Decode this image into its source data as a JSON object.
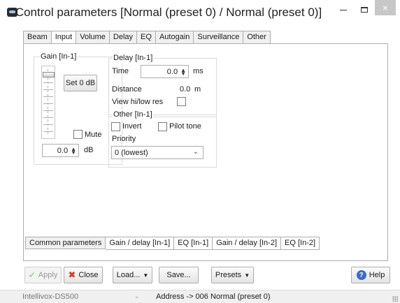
{
  "window": {
    "title": "Control parameters [Normal (preset 0) / Normal (preset 0)]",
    "close_glyph": "×"
  },
  "tabs": [
    {
      "label": "Beam"
    },
    {
      "label": "Input"
    },
    {
      "label": "Volume"
    },
    {
      "label": "Delay"
    },
    {
      "label": "EQ"
    },
    {
      "label": "Autogain"
    },
    {
      "label": "Surveillance"
    },
    {
      "label": "Other"
    }
  ],
  "active_tab": "Input",
  "gain": {
    "group_label": "Gain [In-1]",
    "set0_label": "Set 0 dB",
    "mute_label": "Mute",
    "mute_checked": false,
    "value": "0.0",
    "unit": "dB"
  },
  "delay": {
    "group_label": "Delay [In-1]",
    "time_label": "Time",
    "time_value": "0.0",
    "time_unit": "ms",
    "distance_label": "Distance",
    "distance_value": "0.0",
    "distance_unit": "m",
    "view_res_label": "View hi/low res",
    "view_res_checked": false
  },
  "other": {
    "group_label": "Other [In-1]",
    "invert_label": "Invert",
    "invert_checked": false,
    "pilot_label": "Pilot tone",
    "pilot_checked": false,
    "priority_label": "Priority",
    "priority_value": "0 (lowest)"
  },
  "bottom_tabs": [
    {
      "label": "Common parameters"
    },
    {
      "label": "Gain / delay [In-1]"
    },
    {
      "label": "EQ [In-1]"
    },
    {
      "label": "Gain / delay [In-2]"
    },
    {
      "label": "EQ [In-2]"
    }
  ],
  "active_bottom_tab": "Gain / delay [In-1]",
  "buttons": {
    "apply": "Apply",
    "close": "Close",
    "load": "Load...",
    "save": "Save...",
    "presets": "Presets",
    "help": "Help"
  },
  "status": {
    "device": "Intellivox-DS500",
    "address": "Address -> 006",
    "preset": "Normal (preset 0)"
  }
}
